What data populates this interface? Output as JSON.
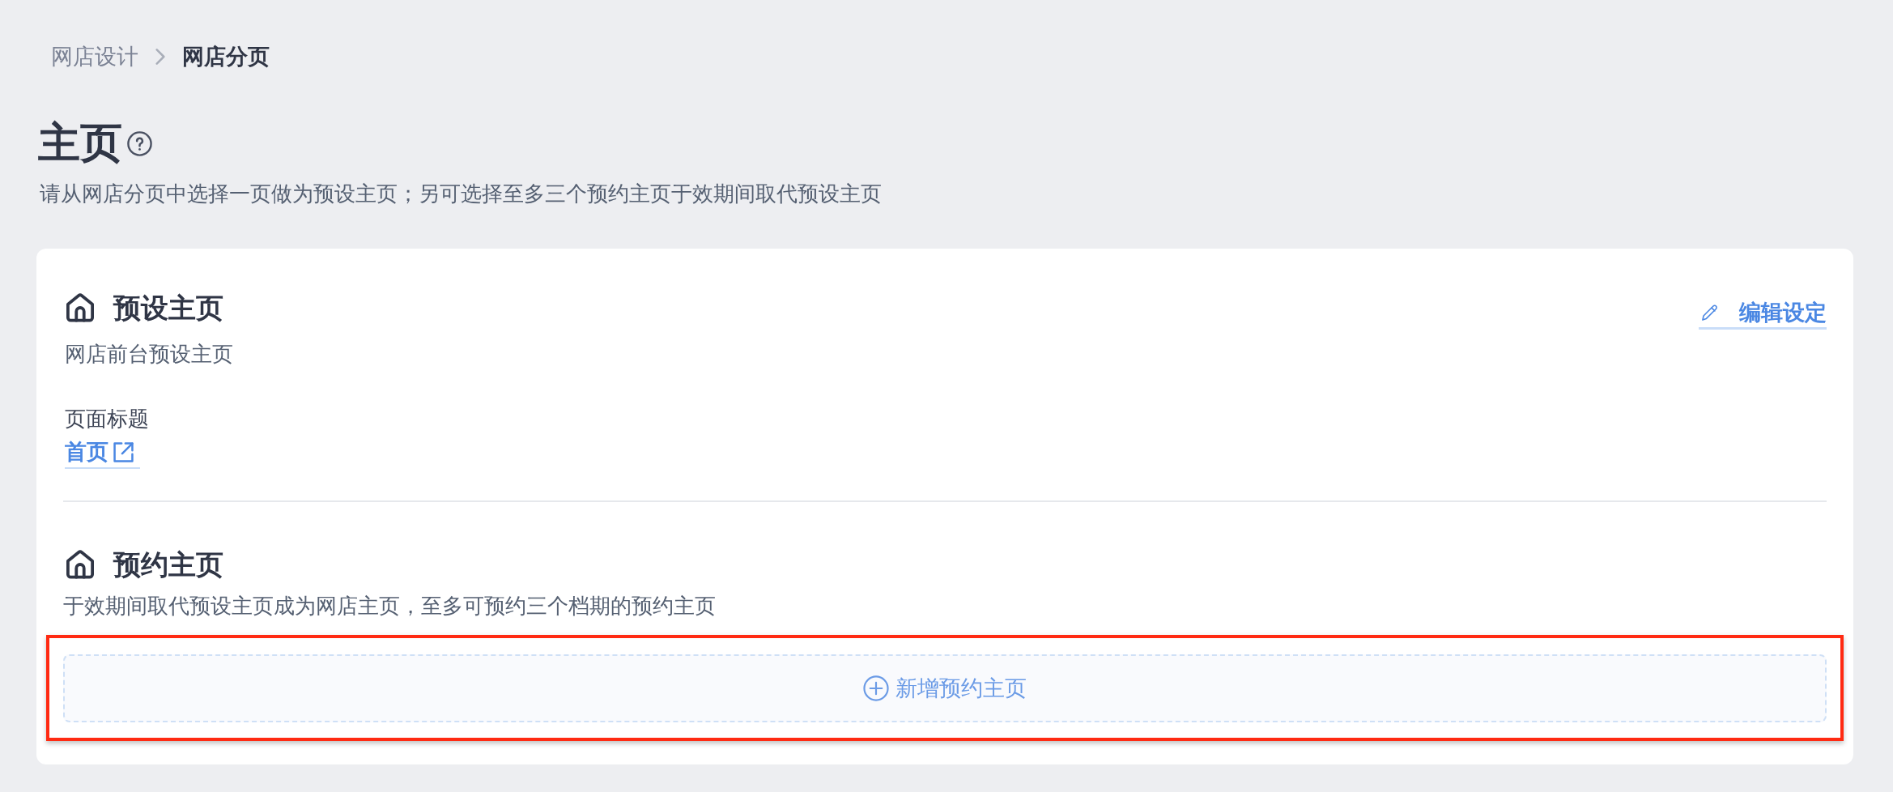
{
  "breadcrumb": [
    {
      "label": "网店设计",
      "current": false
    },
    {
      "label": "网店分页",
      "current": true
    }
  ],
  "page": {
    "title": "主页",
    "description": "请从网店分页中选择一页做为预设主页；另可选择至多三个预约主页于效期间取代预设主页"
  },
  "default_homepage": {
    "title": "预设主页",
    "edit_link": "编辑设定",
    "description": "网店前台预设主页",
    "field_label": "页面标题",
    "page_link": "首页"
  },
  "scheduled_homepage": {
    "title": "预约主页",
    "description": "于效期间取代预设主页成为网店主页，至多可预约三个档期的预约主页",
    "add_button": {
      "label": "新增预约主页",
      "highlighted": true
    }
  }
}
